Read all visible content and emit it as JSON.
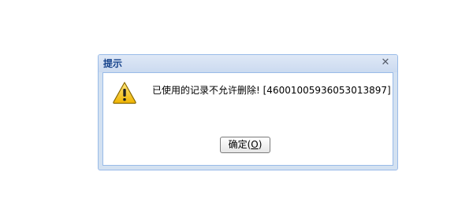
{
  "dialog": {
    "title": "提示",
    "close_glyph": "✕",
    "message": "已使用的记录不允许删除! [46001005936053013897]",
    "ok_button": {
      "label": "确定(",
      "mnemonic": "O",
      "suffix": ")"
    },
    "icon": "warning-icon"
  }
}
